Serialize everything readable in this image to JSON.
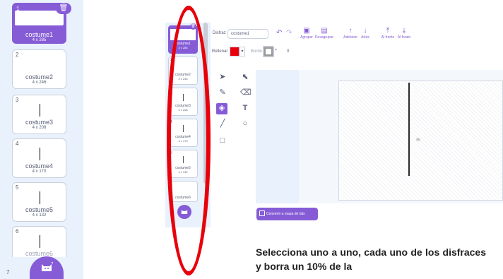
{
  "left_list": {
    "items": [
      {
        "num": "1",
        "name": "costume1",
        "size": "4 x 285"
      },
      {
        "num": "2",
        "name": "costume2",
        "size": "4 x 246"
      },
      {
        "num": "3",
        "name": "costume3",
        "size": "4 x 208"
      },
      {
        "num": "4",
        "name": "costume4",
        "size": "4 x 170"
      },
      {
        "num": "5",
        "name": "costume5",
        "size": "4 x 132"
      },
      {
        "num": "6",
        "name": "costume6",
        "size": ""
      },
      {
        "num": "7",
        "name": "",
        "size": ""
      }
    ]
  },
  "mid_list": {
    "items": [
      {
        "num": "1",
        "name": "costume1",
        "size": "4 x 285"
      },
      {
        "num": "2",
        "name": "costume2",
        "size": "4 x 246"
      },
      {
        "num": "3",
        "name": "costume3",
        "size": "4 x 208"
      },
      {
        "num": "4",
        "name": "costume4",
        "size": "4 x 170"
      },
      {
        "num": "5",
        "name": "costume5",
        "size": "4 x 132"
      },
      {
        "num": "6",
        "name": "costume6",
        "size": ""
      }
    ]
  },
  "toolbar": {
    "costume_label": "Disfraz",
    "costume_value": "costume1",
    "fill_label": "Rellenar",
    "border_label": "Borde",
    "border_width": "0",
    "buttons": [
      "Agrupar",
      "Desagrupar",
      "Adelante",
      "Atrás",
      "Al frente",
      "Al fondo"
    ]
  },
  "convert_button": "Convertir a mapa de bits",
  "instruction": "Selecciona uno a uno, cada uno de los disfraces y borra un 10% de la",
  "colors": {
    "accent": "#855cd6",
    "fill": "#e8000b",
    "annotation": "#e8000b"
  }
}
